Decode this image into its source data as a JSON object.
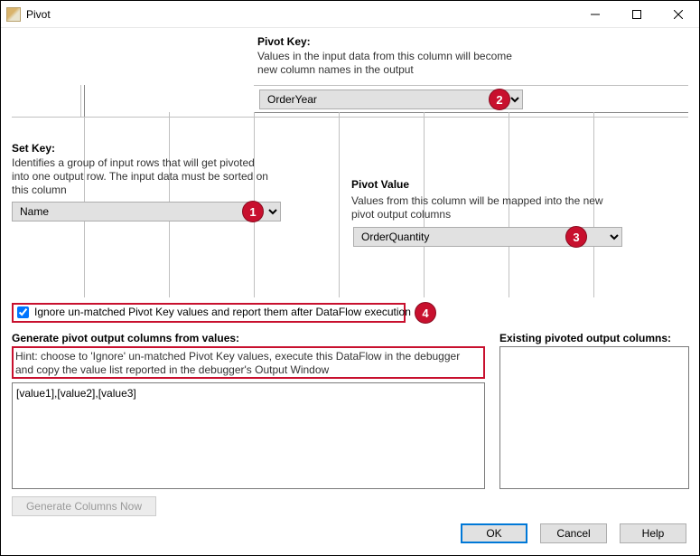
{
  "window": {
    "title": "Pivot"
  },
  "pivotKey": {
    "label": "Pivot Key:",
    "desc1": "Values in the input data from this column will become",
    "desc2": "new column names in the output",
    "value": "OrderYear"
  },
  "setKey": {
    "label": "Set Key:",
    "desc1": "Identifies a group of input rows that will get pivoted",
    "desc2": "into one output row. The input data must be sorted on",
    "desc3": "this column",
    "value": "Name"
  },
  "pivotValue": {
    "label": "Pivot Value",
    "desc1": "Values from this column will be mapped into the new",
    "desc2": "pivot output columns",
    "value": "OrderQuantity"
  },
  "ignore": {
    "label": "Ignore un-matched Pivot Key values and report them after DataFlow execution",
    "checked": true
  },
  "generate": {
    "label": "Generate pivot output columns from values:",
    "hint1": "Hint: choose to 'Ignore' un-matched Pivot Key values, execute this DataFlow in the debugger",
    "hint2": "and copy the value list reported in the debugger's Output Window",
    "value": "[value1],[value2],[value3]"
  },
  "existing": {
    "label": "Existing pivoted output columns:"
  },
  "buttons": {
    "generate": "Generate Columns Now",
    "ok": "OK",
    "cancel": "Cancel",
    "help": "Help"
  },
  "badges": {
    "b1": "1",
    "b2": "2",
    "b3": "3",
    "b4": "4"
  }
}
